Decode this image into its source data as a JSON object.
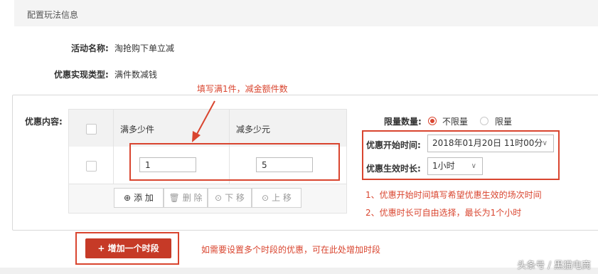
{
  "section": {
    "title": "配置玩法信息"
  },
  "activity": {
    "name_label": "活动名称:",
    "name_value": "淘抢购下单立减",
    "type_label": "优惠实现类型:",
    "type_value": "满件数减钱"
  },
  "annotations": {
    "top": "填写满1件，减金额件数",
    "note1": "1、优惠开始时间填写希望优惠生效的场次时间",
    "note2": "2、优惠时长可自由选择，最长为1个小时",
    "bottom": "如需要设置多个时段的优惠，可在此处增加时段"
  },
  "discount": {
    "label": "优惠内容:",
    "columns": [
      "满多少件",
      "减多少元"
    ],
    "row": {
      "min_qty": "1",
      "reduce_amount": "5"
    },
    "toolbar": {
      "add": "添 加",
      "delete": "删 除",
      "down": "下 移",
      "up": "上 移"
    }
  },
  "limit": {
    "label": "限量数量:",
    "options": [
      "不限量",
      "限量"
    ],
    "selected": "不限量"
  },
  "start_time": {
    "label": "优惠开始时间:",
    "value": "2018年01月20日 11时00分"
  },
  "duration": {
    "label": "优惠生效时长:",
    "value": "1小时"
  },
  "add_period_button": "+  增加一个时段",
  "watermark": "头条号 / 黑猫电商",
  "colors": {
    "accent": "#d9452f",
    "button": "#c63a27"
  }
}
